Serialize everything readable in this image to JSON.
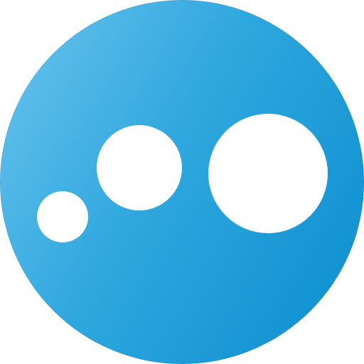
{
  "logo": {
    "icon_name": "three-dots-bubble-logo-icon",
    "colors": {
      "gradient_light": "#6CC4EE",
      "gradient_mid": "#2FA7DE",
      "gradient_dark": "#0A8DCF",
      "dots": "#FFFFFF",
      "background": "#FFFFFF"
    }
  }
}
